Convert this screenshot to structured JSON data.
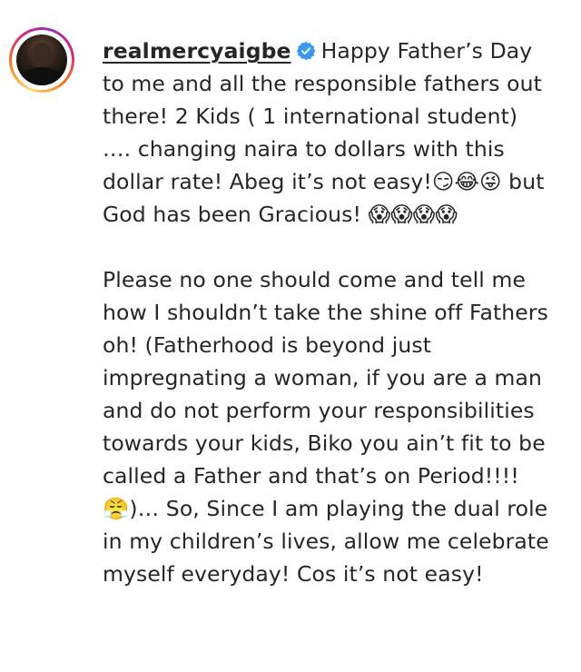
{
  "post": {
    "username": "realmercyaigbe",
    "verified": true,
    "caption_first": "Happy Father’s Day to me and all the responsible fathers out there! 2 Kids ( 1 international student) …. changing naira to dollars with this dollar rate! Abeg it’s not easy!😏😂😜 but God has been Gracious! 😱😱😱😱",
    "caption_second": "Please no one should come and tell me how I shouldn’t take the shine off Fathers oh! (Fatherhood is beyond just impregnating a woman, if you are a man and do not perform your responsibilities towards your kids, Biko you ain’t fit to be called a Father and that’s on Period!!!!😤)… So, Since I am playing the dual role in my children’s lives, allow me celebrate myself everyday! Cos it’s not easy!"
  },
  "colors": {
    "text": "#262626",
    "verified_badge": "#3897f0",
    "ring_start": "#feda75",
    "ring_mid": "#d62976",
    "ring_end": "#962fbf"
  },
  "icons": {
    "avatar": "profile-photo",
    "verified": "verified-badge-icon"
  }
}
